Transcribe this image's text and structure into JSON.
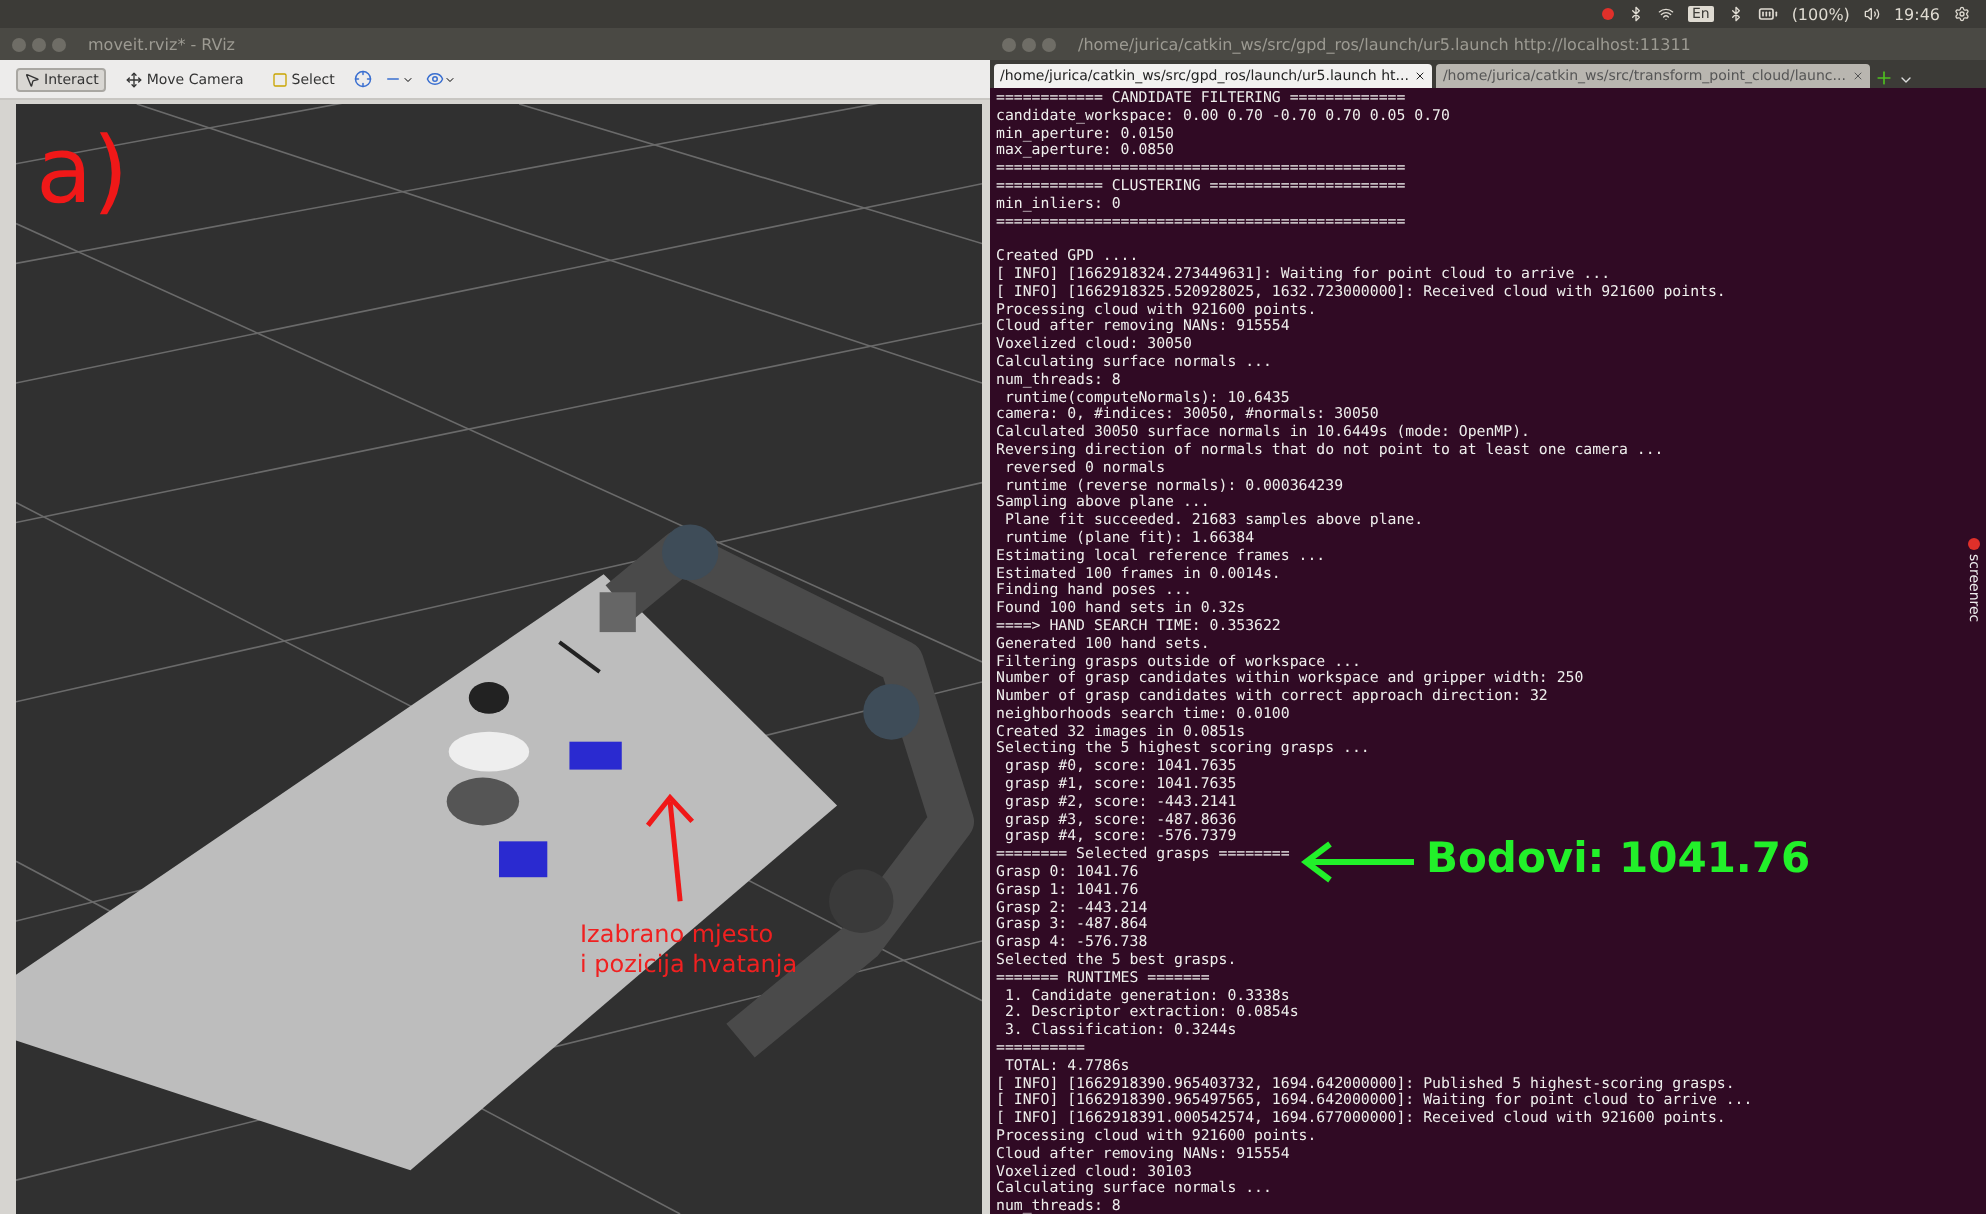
{
  "top_panel": {
    "keyboard": "En",
    "battery": "(100%)",
    "clock": "19:46"
  },
  "rviz": {
    "title": "moveit.rviz* - RViz",
    "tools": [
      {
        "kind": "interact",
        "label": "Interact",
        "selected": true
      },
      {
        "kind": "camera",
        "label": "Move Camera",
        "selected": false
      },
      {
        "kind": "select",
        "label": "Select",
        "selected": false
      }
    ],
    "annotation": "a)",
    "scene_label": [
      "Izabrano mjesto",
      "i pozicija hvatanja"
    ]
  },
  "terminal": {
    "title": "/home/jurica/catkin_ws/src/gpd_ros/launch/ur5.launch http://localhost:11311",
    "tabs": [
      {
        "label": "/home/jurica/catkin_ws/src/gpd_ros/launch/ur5.launch ht...",
        "selected": true
      },
      {
        "label": "/home/jurica/catkin_ws/src/transform_point_cloud/launc...",
        "selected": false
      }
    ],
    "blocks": [
      [
        "============ CANDIDATE FILTERING =============",
        "candidate_workspace: 0.00 0.70 -0.70 0.70 0.05 0.70",
        "min_aperture: 0.0150",
        "max_aperture: 0.0850",
        "==============================================",
        "============ CLUSTERING ======================",
        "min_inliers: 0",
        "=============================================="
      ],
      [
        "Created GPD ....",
        "[ INFO] [1662918324.273449631]: Waiting for point cloud to arrive ...",
        "[ INFO] [1662918325.520928025, 1632.723000000]: Received cloud with 921600 points.",
        "Processing cloud with 921600 points.",
        "Cloud after removing NANs: 915554",
        "Voxelized cloud: 30050",
        "Calculating surface normals ...",
        "num_threads: 8",
        " runtime(computeNormals): 10.6435",
        "camera: 0, #indices: 30050, #normals: 30050",
        "Calculated 30050 surface normals in 10.6449s (mode: OpenMP).",
        "Reversing direction of normals that do not point to at least one camera ...",
        " reversed 0 normals",
        " runtime (reverse normals): 0.000364239",
        "Sampling above plane ...",
        " Plane fit succeeded. 21683 samples above plane.",
        " runtime (plane fit): 1.66384",
        "Estimating local reference frames ...",
        "Estimated 100 frames in 0.0014s.",
        "Finding hand poses ...",
        "Found 100 hand sets in 0.32s",
        "====> HAND SEARCH TIME: 0.353622",
        "Generated 100 hand sets.",
        "Filtering grasps outside of workspace ...",
        "Number of grasp candidates within workspace and gripper width: 250",
        "Number of grasp candidates with correct approach direction: 32",
        "neighborhoods search time: 0.0100",
        "Created 32 images in 0.0851s",
        "Selecting the 5 highest scoring grasps ...",
        " grasp #0, score: 1041.7635",
        " grasp #1, score: 1041.7635",
        " grasp #2, score: -443.2141",
        " grasp #3, score: -487.8636",
        " grasp #4, score: -576.7379",
        "======== Selected grasps ========",
        "Grasp 0: 1041.76",
        "Grasp 1: 1041.76",
        "Grasp 2: -443.214",
        "Grasp 3: -487.864",
        "Grasp 4: -576.738",
        "Selected the 5 best grasps.",
        "======= RUNTIMES =======",
        " 1. Candidate generation: 0.3338s",
        " 2. Descriptor extraction: 0.0854s",
        " 3. Classification: 0.3244s",
        "==========",
        " TOTAL: 4.7786s",
        "[ INFO] [1662918390.965403732, 1694.642000000]: Published 5 highest-scoring grasps.",
        "[ INFO] [1662918390.965497565, 1694.642000000]: Waiting for point cloud to arrive ...",
        "[ INFO] [1662918391.000542574, 1694.677000000]: Received cloud with 921600 points.",
        "Processing cloud with 921600 points.",
        "Cloud after removing NANs: 915554",
        "Voxelized cloud: 30103",
        "Calculating surface normals ...",
        "num_threads: 8"
      ]
    ],
    "annotation": "Bodovi: 1041.76",
    "side_label": "screenrec"
  }
}
